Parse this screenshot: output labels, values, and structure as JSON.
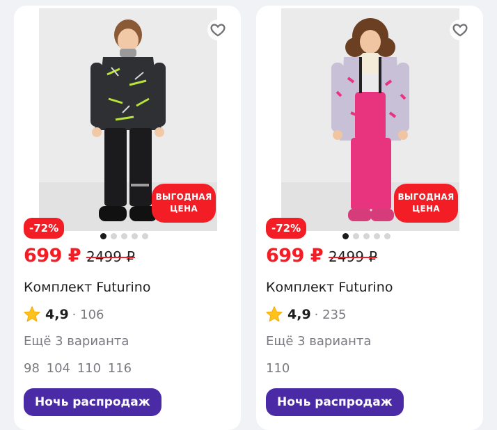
{
  "products": [
    {
      "badge_line1": "ВЫГОДНАЯ",
      "badge_line2": "ЦЕНА",
      "discount": "-72%",
      "price": "699 ₽",
      "old_price": "2499 ₽",
      "title": "Комплект Futurino",
      "rating": "4,9",
      "reviews": "· 106",
      "variants": "Ещё 3 варианта",
      "sizes": "98 104 110 116",
      "promo_label": "Ночь распродаж",
      "gallery_dots": 5,
      "active_dot": 1,
      "colors": {
        "jacket": "#2f3034",
        "pants": "#1b1b1d",
        "accent": "#b9e23a"
      }
    },
    {
      "badge_line1": "ВЫГОДНАЯ",
      "badge_line2": "ЦЕНА",
      "discount": "-72%",
      "price": "699 ₽",
      "old_price": "2499 ₽",
      "title": "Комплект Futurino",
      "rating": "4,9",
      "reviews": "· 235",
      "variants": "Ещё 3 варианта",
      "sizes": "110",
      "promo_label": "Ночь распродаж",
      "gallery_dots": 5,
      "active_dot": 1,
      "colors": {
        "jacket": "#c7c0d6",
        "pants": "#e8337e",
        "accent": "#e8337e"
      }
    }
  ],
  "icons": {
    "favorite": "heart-outline-icon",
    "rating": "star-icon"
  },
  "theme": {
    "sale_red": "#f21d25",
    "promo_purple": "#4b2aa6",
    "star_yellow": "#ffc21c"
  }
}
